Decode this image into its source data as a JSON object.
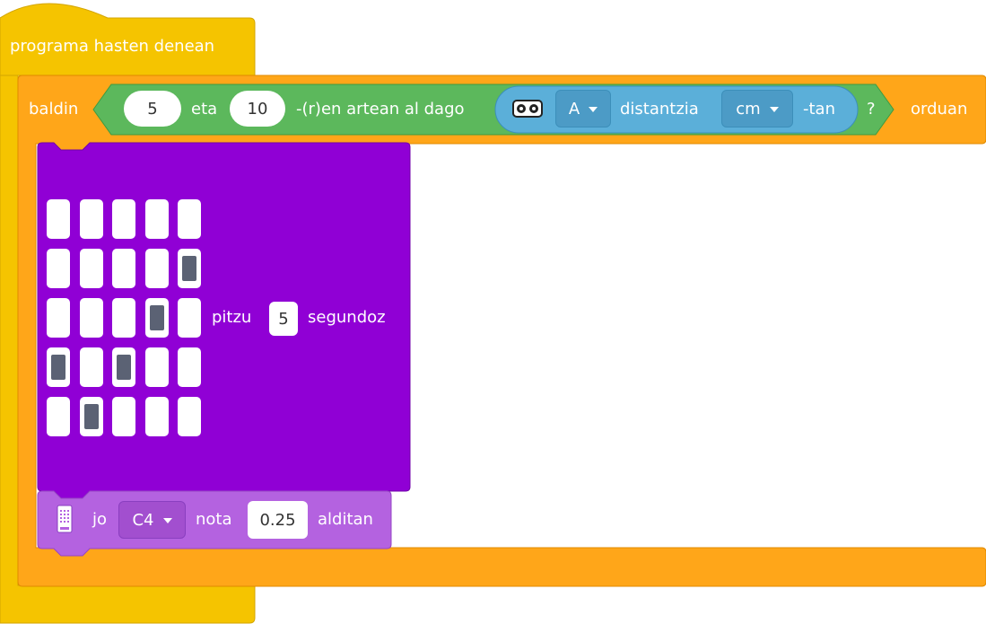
{
  "hat": {
    "label": "programa hasten denean"
  },
  "if_block": {
    "label_if": "baldin",
    "label_then": "orduan",
    "condition": {
      "value_low": "5",
      "and_label": "eta",
      "value_high": "10",
      "between_label": "-(r)en artean al dago",
      "sensor": {
        "icon": "ultrasonic-sensor-icon",
        "port": "A",
        "distance_label": "distantzia",
        "unit": "cm",
        "unit_suffix": "-tan",
        "question": "?"
      }
    }
  },
  "led_block": {
    "grid": [
      [
        0,
        0,
        0,
        0,
        0
      ],
      [
        0,
        0,
        0,
        0,
        1
      ],
      [
        0,
        0,
        0,
        1,
        0
      ],
      [
        1,
        0,
        1,
        0,
        0
      ],
      [
        0,
        1,
        0,
        0,
        0
      ]
    ],
    "light_label": "pitzu",
    "seconds": "5",
    "seconds_label": "segundoz"
  },
  "note_block": {
    "icon": "microbit-icon",
    "play_label": "jo",
    "note": "C4",
    "note_label": "nota",
    "duration": "0.25",
    "times_label": "alditan"
  },
  "colors": {
    "events": "#F5C400",
    "control": "#FFA619",
    "operator": "#5CB85C",
    "sensor": "#5BAFD9",
    "display": "#9000D5",
    "sound": "#B462E0"
  }
}
